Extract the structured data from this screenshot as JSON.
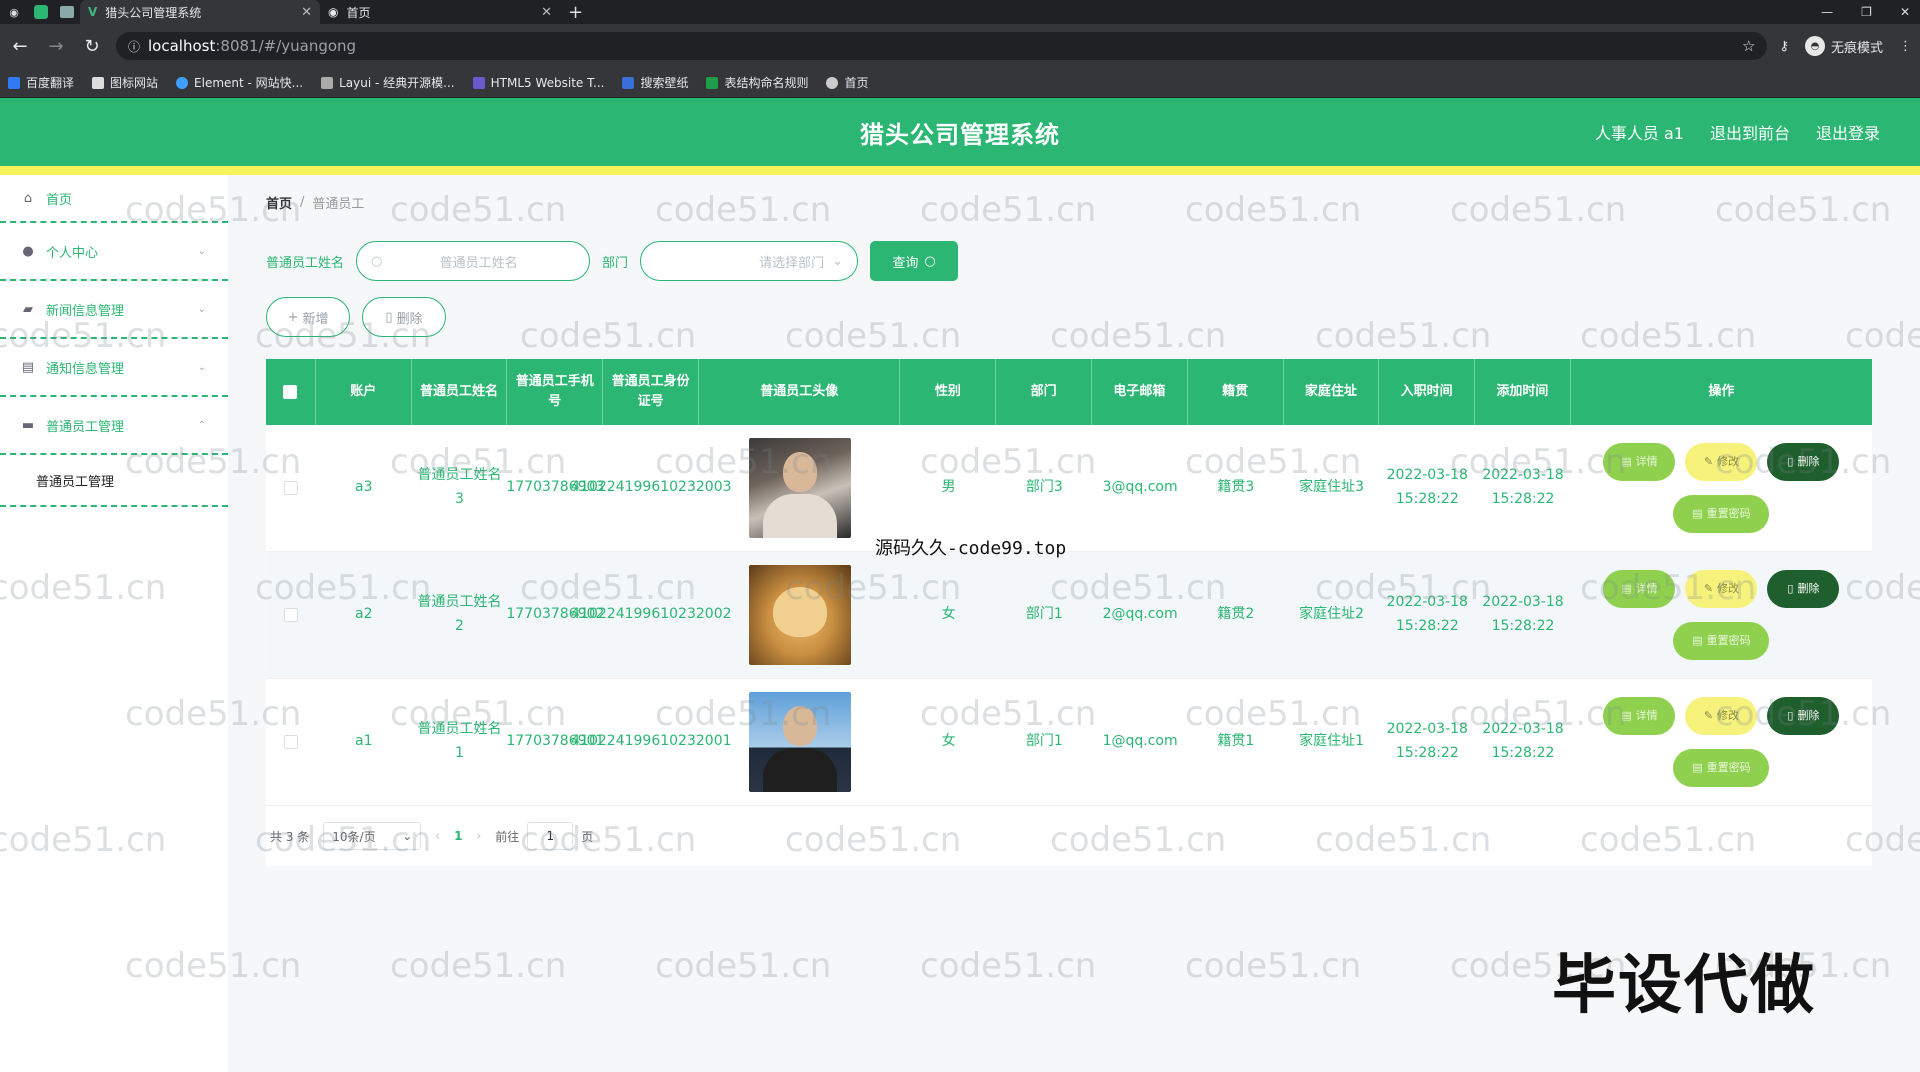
{
  "browser": {
    "tabs": [
      {
        "title": "猎头公司管理系统",
        "active": true
      },
      {
        "title": "首页",
        "active": false
      }
    ],
    "url_host": "localhost",
    "url_path": ":8081/#/yuangong",
    "incognito_label": "无痕模式",
    "bookmarks": [
      "百度翻译",
      "图标网站",
      "Element - 网站快...",
      "Layui - 经典开源模...",
      "HTML5 Website T...",
      "搜索壁纸",
      "表结构命名规则",
      "首页"
    ]
  },
  "header": {
    "title": "猎头公司管理系统",
    "user": "人事人员 a1",
    "back_front": "退出到前台",
    "logout": "退出登录"
  },
  "sidebar": {
    "items": [
      {
        "label": "首页",
        "icon": "home-icon"
      },
      {
        "label": "个人中心",
        "icon": "user-icon"
      },
      {
        "label": "新闻信息管理",
        "icon": "news-icon"
      },
      {
        "label": "通知信息管理",
        "icon": "notice-icon"
      },
      {
        "label": "普通员工管理",
        "icon": "staff-icon"
      }
    ],
    "subitem": "普通员工管理"
  },
  "breadcrumb": {
    "home": "首页",
    "sep": "/",
    "current": "普通员工"
  },
  "search": {
    "name_label": "普通员工姓名",
    "name_placeholder": "普通员工姓名",
    "dept_label": "部门",
    "dept_placeholder": "请选择部门",
    "query_label": "查询"
  },
  "actions": {
    "add_label": "新增",
    "delete_label": "删除"
  },
  "table": {
    "headers": [
      "账户",
      "普通员工姓名",
      "普通员工手机号",
      "普通员工身份证号",
      "普通员工头像",
      "性别",
      "部门",
      "电子邮箱",
      "籍贯",
      "家庭住址",
      "入职时间",
      "添加时间",
      "操作"
    ],
    "rows": [
      {
        "account": "a3",
        "name": "普通员工姓名3",
        "phone": "17703786903",
        "idno": "410224199610232003",
        "sex": "男",
        "dept": "部门3",
        "email": "3@qq.com",
        "native": "籍贯3",
        "addr": "家庭住址3",
        "join": "2022-03-18 15:28:22",
        "added": "2022-03-18 15:28:22"
      },
      {
        "account": "a2",
        "name": "普通员工姓名2",
        "phone": "17703786902",
        "idno": "410224199610232002",
        "sex": "女",
        "dept": "部门1",
        "email": "2@qq.com",
        "native": "籍贯2",
        "addr": "家庭住址2",
        "join": "2022-03-18 15:28:22",
        "added": "2022-03-18 15:28:22"
      },
      {
        "account": "a1",
        "name": "普通员工姓名1",
        "phone": "17703786901",
        "idno": "410224199610232001",
        "sex": "女",
        "dept": "部门1",
        "email": "1@qq.com",
        "native": "籍贯1",
        "addr": "家庭住址1",
        "join": "2022-03-18 15:28:22",
        "added": "2022-03-18 15:28:22"
      }
    ],
    "ops": {
      "detail": "详情",
      "edit": "修改",
      "delete": "删除",
      "reset": "重置密码"
    }
  },
  "pager": {
    "total": "共 3 条",
    "page_size": "10条/页",
    "current": "1",
    "goto": "前往",
    "goto_value": "1",
    "page_unit": "页"
  },
  "overlay": {
    "watermark": "code51.cn",
    "caption_small": "源码久久-code99.top",
    "caption_big": "毕设代做"
  },
  "colors": {
    "primary": "#2bb673",
    "accent_yellow": "#f5f25a",
    "delete_dark": "#1f5e2d"
  }
}
